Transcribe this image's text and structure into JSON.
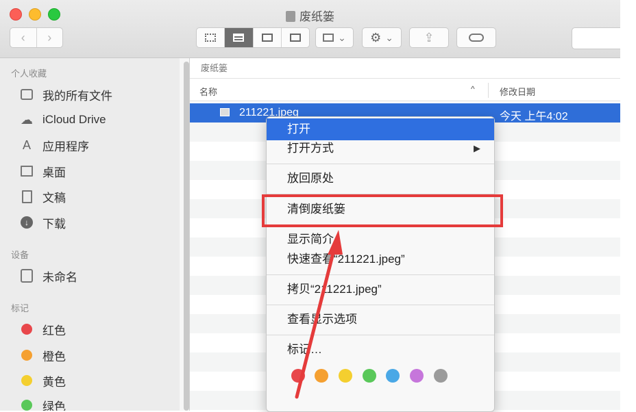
{
  "window": {
    "title": "废纸篓"
  },
  "toolbar": {
    "back": "‹",
    "forward": "›",
    "arrange_chevron": "⌄",
    "gear": "⚙",
    "gear_chevron": "⌄",
    "share": "⇪",
    "tag": "⌂"
  },
  "sidebar": {
    "sections": [
      {
        "title": "个人收藏",
        "items": [
          {
            "label": "我的所有文件",
            "icon": "all-files-icon"
          },
          {
            "label": "iCloud Drive",
            "icon": "cloud-icon"
          },
          {
            "label": "应用程序",
            "icon": "applications-icon"
          },
          {
            "label": "桌面",
            "icon": "desktop-icon"
          },
          {
            "label": "文稿",
            "icon": "documents-icon"
          },
          {
            "label": "下载",
            "icon": "download-icon"
          }
        ]
      },
      {
        "title": "设备",
        "items": [
          {
            "label": "未命名",
            "icon": "disk-icon"
          }
        ]
      },
      {
        "title": "标记",
        "items": [
          {
            "label": "红色",
            "color": "#e8474b"
          },
          {
            "label": "橙色",
            "color": "#f5a031"
          },
          {
            "label": "黄色",
            "color": "#f4cf2f"
          },
          {
            "label": "绿色",
            "color": "#5ac85a"
          }
        ]
      }
    ]
  },
  "main": {
    "path": "废纸篓",
    "columns": {
      "name": "名称",
      "date": "修改日期",
      "sort_indicator": "^"
    },
    "selected_file": {
      "name": "211221.jpeg",
      "date": "今天 上午4:02"
    }
  },
  "context_menu": {
    "items": [
      "打开",
      "打开方式",
      "放回原处",
      "清倒废纸篓",
      "显示简介",
      "快速查看“211221.jpeg”",
      "拷贝“211221.jpeg”",
      "查看显示选项",
      "标记…"
    ],
    "submenu_arrow": "▶",
    "tag_colors": [
      "#e8474b",
      "#f5a031",
      "#f4cf2f",
      "#5ac85a",
      "#4aa8e6",
      "#c676db",
      "#9b9b9b"
    ]
  }
}
